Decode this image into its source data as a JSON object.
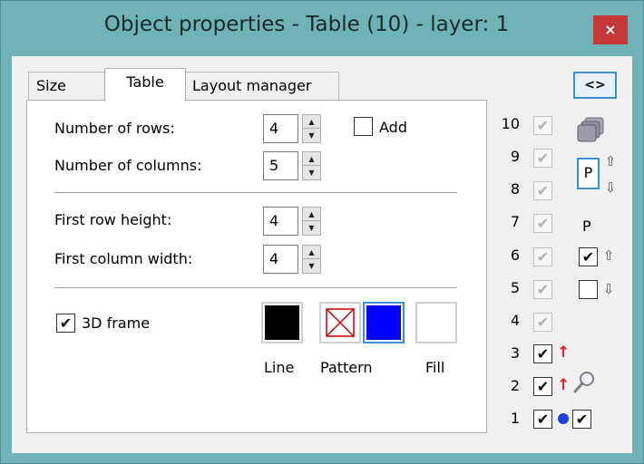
{
  "window": {
    "title": "Object properties - Table (10) - layer: 1",
    "close_label": "×"
  },
  "tabs": [
    {
      "label": "Size",
      "active": false
    },
    {
      "label": "Table",
      "active": true
    },
    {
      "label": "Layout manager",
      "active": false
    }
  ],
  "table_panel": {
    "rows_label": "Number of rows:",
    "rows_value": "4",
    "columns_label": "Number of columns:",
    "columns_value": "5",
    "add_label": "Add",
    "add_checked": false,
    "first_row_height_label": "First row height:",
    "first_row_height_value": "4",
    "first_column_width_label": "First column width:",
    "first_column_width_value": "4",
    "frame_3d_label": "3D frame",
    "frame_3d_checked": true,
    "line_label": "Line",
    "pattern_label": "Pattern",
    "fill_label": "Fill",
    "colors": {
      "line": "#000000",
      "pattern_fill": "#0000ff",
      "fill": "#ffffff"
    }
  },
  "right_panel": {
    "code_button_label": "<>",
    "layers": [
      {
        "number": "10",
        "checked": true,
        "enabled": false
      },
      {
        "number": "9",
        "checked": true,
        "enabled": false
      },
      {
        "number": "8",
        "checked": true,
        "enabled": false
      },
      {
        "number": "7",
        "checked": true,
        "enabled": false
      },
      {
        "number": "6",
        "checked": true,
        "enabled": false
      },
      {
        "number": "5",
        "checked": true,
        "enabled": false
      },
      {
        "number": "4",
        "checked": true,
        "enabled": false
      },
      {
        "number": "3",
        "checked": true,
        "enabled": true
      },
      {
        "number": "2",
        "checked": true,
        "enabled": true
      },
      {
        "number": "1",
        "checked": true,
        "enabled": true
      }
    ],
    "p_label": "P",
    "p_label_2": "P",
    "print_checkbox_checked": true,
    "second_checkbox_checked": false,
    "layer1_extra_checked": true,
    "icons": [
      "layers-icon",
      "arrow-up-icon",
      "arrow-down-icon",
      "red-arrow-up-icon",
      "magnifier-icon",
      "blue-dot-icon"
    ]
  }
}
